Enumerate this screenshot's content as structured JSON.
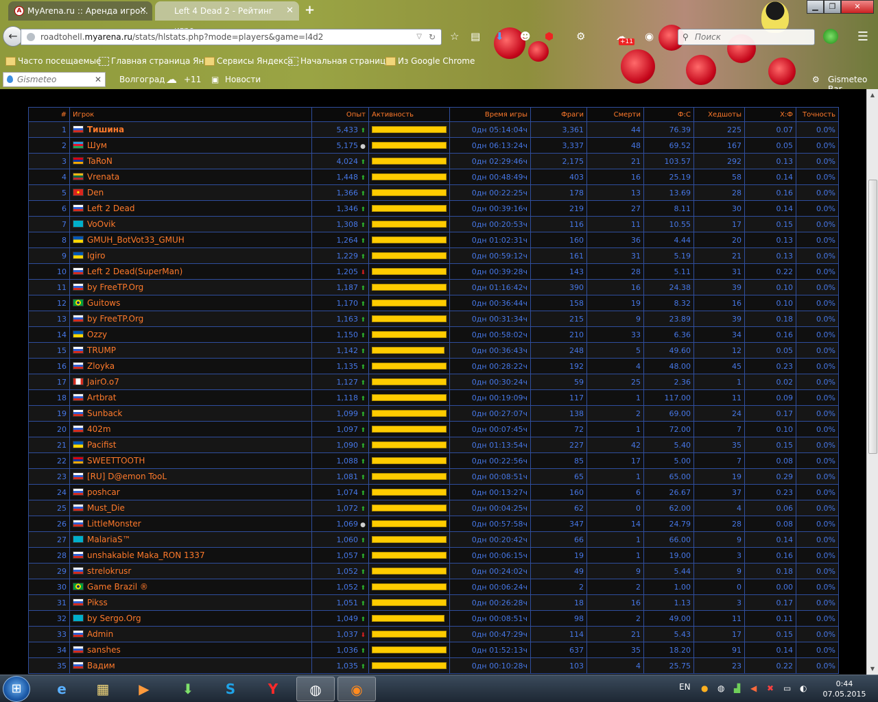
{
  "browser": {
    "tabs": [
      {
        "title": "MyArena.ru :: Аренда игро...",
        "active": false
      },
      {
        "title": "Left 4 Dead 2 - Рейтинг игро...",
        "active": true
      }
    ],
    "url_path_pre": "roadtohell.",
    "url_host": "myarena.ru",
    "url_path_post": "/stats/hlstats.php?mode=players&game=l4d2",
    "search_placeholder": "Поиск",
    "bookmarks": [
      "Часто посещаемые",
      "Главная страница Ян...",
      "Сервисы Яндекса",
      "Начальная страница",
      "Из Google Chrome"
    ],
    "gismeteo": {
      "search_placeholder": "Gismeteo",
      "city": "Волгоград",
      "temp": "+11",
      "news": "Новости",
      "bar_label": "Gismeteo Bar"
    },
    "badge": "+11"
  },
  "table": {
    "headers": [
      "#",
      "Игрок",
      "Опыт",
      "Активность",
      "Время игры",
      "Фраги",
      "Смерти",
      "Ф:С",
      "Хедшоты",
      "Х:Ф",
      "Точность"
    ],
    "rows": [
      {
        "rank": "1",
        "flag": "ru",
        "name": "Тишина",
        "bold": true,
        "exp": "5,433",
        "trend": "up",
        "activity": 1.0,
        "time": "0дн 05:14:04ч",
        "kills": "3,361",
        "deaths": "44",
        "kd": "76.39",
        "hs": "225",
        "hk": "0.07",
        "acc": "0.0%"
      },
      {
        "rank": "2",
        "flag": "az",
        "name": "Шум",
        "exp": "5,175",
        "trend": "same",
        "activity": 1.0,
        "time": "0дн 06:13:24ч",
        "kills": "3,337",
        "deaths": "48",
        "kd": "69.52",
        "hs": "167",
        "hk": "0.05",
        "acc": "0.0%"
      },
      {
        "rank": "3",
        "flag": "am",
        "name": "TaRoN",
        "exp": "4,024",
        "trend": "up",
        "activity": 1.0,
        "time": "0дн 02:29:46ч",
        "kills": "2,175",
        "deaths": "21",
        "kd": "103.57",
        "hs": "292",
        "hk": "0.13",
        "acc": "0.0%"
      },
      {
        "rank": "4",
        "flag": "lt",
        "name": "Vrenata",
        "exp": "1,448",
        "trend": "up",
        "activity": 1.0,
        "time": "0дн 00:48:49ч",
        "kills": "403",
        "deaths": "16",
        "kd": "25.19",
        "hs": "58",
        "hk": "0.14",
        "acc": "0.0%"
      },
      {
        "rank": "5",
        "flag": "vn",
        "name": "Den",
        "exp": "1,366",
        "trend": "up",
        "activity": 1.0,
        "time": "0дн 00:22:25ч",
        "kills": "178",
        "deaths": "13",
        "kd": "13.69",
        "hs": "28",
        "hk": "0.16",
        "acc": "0.0%"
      },
      {
        "rank": "6",
        "flag": "ru",
        "name": "Left 2 Dead",
        "exp": "1,346",
        "trend": "up",
        "activity": 1.0,
        "time": "0дн 00:39:16ч",
        "kills": "219",
        "deaths": "27",
        "kd": "8.11",
        "hs": "30",
        "hk": "0.14",
        "acc": "0.0%"
      },
      {
        "rank": "7",
        "flag": "kz",
        "name": "VoOvik",
        "exp": "1,308",
        "trend": "up",
        "activity": 1.0,
        "time": "0дн 00:20:53ч",
        "kills": "116",
        "deaths": "11",
        "kd": "10.55",
        "hs": "17",
        "hk": "0.15",
        "acc": "0.0%"
      },
      {
        "rank": "8",
        "flag": "ua",
        "name": "GMUH_BotVot33_GMUH",
        "exp": "1,264",
        "trend": "up",
        "activity": 1.0,
        "time": "0дн 01:02:31ч",
        "kills": "160",
        "deaths": "36",
        "kd": "4.44",
        "hs": "20",
        "hk": "0.13",
        "acc": "0.0%"
      },
      {
        "rank": "9",
        "flag": "ua",
        "name": "Igiro",
        "exp": "1,229",
        "trend": "up",
        "activity": 1.0,
        "time": "0дн 00:59:12ч",
        "kills": "161",
        "deaths": "31",
        "kd": "5.19",
        "hs": "21",
        "hk": "0.13",
        "acc": "0.0%"
      },
      {
        "rank": "10",
        "flag": "ru",
        "name": "Left 2 Dead(SuperMan)",
        "exp": "1,205",
        "trend": "down",
        "activity": 1.0,
        "time": "0дн 00:39:28ч",
        "kills": "143",
        "deaths": "28",
        "kd": "5.11",
        "hs": "31",
        "hk": "0.22",
        "acc": "0.0%"
      },
      {
        "rank": "11",
        "flag": "ru",
        "name": "by FreeTP.Org",
        "exp": "1,187",
        "trend": "up",
        "activity": 1.0,
        "time": "0дн 01:16:42ч",
        "kills": "390",
        "deaths": "16",
        "kd": "24.38",
        "hs": "39",
        "hk": "0.10",
        "acc": "0.0%"
      },
      {
        "rank": "12",
        "flag": "br",
        "name": "Guitows",
        "exp": "1,170",
        "trend": "up",
        "activity": 1.0,
        "time": "0дн 00:36:44ч",
        "kills": "158",
        "deaths": "19",
        "kd": "8.32",
        "hs": "16",
        "hk": "0.10",
        "acc": "0.0%"
      },
      {
        "rank": "13",
        "flag": "ru",
        "name": "by FreeTP.Org",
        "exp": "1,163",
        "trend": "up",
        "activity": 1.0,
        "time": "0дн 00:31:34ч",
        "kills": "215",
        "deaths": "9",
        "kd": "23.89",
        "hs": "39",
        "hk": "0.18",
        "acc": "0.0%"
      },
      {
        "rank": "14",
        "flag": "ua",
        "name": "Ozzy",
        "exp": "1,150",
        "trend": "up",
        "activity": 1.0,
        "time": "0дн 00:58:02ч",
        "kills": "210",
        "deaths": "33",
        "kd": "6.36",
        "hs": "34",
        "hk": "0.16",
        "acc": "0.0%"
      },
      {
        "rank": "15",
        "flag": "ru",
        "name": "TRUMP",
        "exp": "1,142",
        "trend": "up",
        "activity": 0.97,
        "time": "0дн 00:36:43ч",
        "kills": "248",
        "deaths": "5",
        "kd": "49.60",
        "hs": "12",
        "hk": "0.05",
        "acc": "0.0%"
      },
      {
        "rank": "16",
        "flag": "ru",
        "name": "Zloyka",
        "exp": "1,135",
        "trend": "up",
        "activity": 1.0,
        "time": "0дн 00:28:22ч",
        "kills": "192",
        "deaths": "4",
        "kd": "48.00",
        "hs": "45",
        "hk": "0.23",
        "acc": "0.0%"
      },
      {
        "rank": "17",
        "flag": "ca",
        "name": "JairO.o7",
        "exp": "1,127",
        "trend": "up",
        "activity": 1.0,
        "time": "0дн 00:30:24ч",
        "kills": "59",
        "deaths": "25",
        "kd": "2.36",
        "hs": "1",
        "hk": "0.02",
        "acc": "0.0%"
      },
      {
        "rank": "18",
        "flag": "ru",
        "name": "Artbrat",
        "exp": "1,118",
        "trend": "up",
        "activity": 1.0,
        "time": "0дн 00:19:09ч",
        "kills": "117",
        "deaths": "1",
        "kd": "117.00",
        "hs": "11",
        "hk": "0.09",
        "acc": "0.0%"
      },
      {
        "rank": "19",
        "flag": "ru",
        "name": "Sunback",
        "exp": "1,099",
        "trend": "up",
        "activity": 1.0,
        "time": "0дн 00:27:07ч",
        "kills": "138",
        "deaths": "2",
        "kd": "69.00",
        "hs": "24",
        "hk": "0.17",
        "acc": "0.0%"
      },
      {
        "rank": "20",
        "flag": "ru",
        "name": "402m",
        "exp": "1,097",
        "trend": "up",
        "activity": 1.0,
        "time": "0дн 00:07:45ч",
        "kills": "72",
        "deaths": "1",
        "kd": "72.00",
        "hs": "7",
        "hk": "0.10",
        "acc": "0.0%"
      },
      {
        "rank": "21",
        "flag": "ua",
        "name": "Pacifist",
        "exp": "1,090",
        "trend": "up",
        "activity": 1.0,
        "time": "0дн 01:13:54ч",
        "kills": "227",
        "deaths": "42",
        "kd": "5.40",
        "hs": "35",
        "hk": "0.15",
        "acc": "0.0%"
      },
      {
        "rank": "22",
        "flag": "am",
        "name": "SWEETTOOTH",
        "exp": "1,088",
        "trend": "up",
        "activity": 1.0,
        "time": "0дн 00:22:56ч",
        "kills": "85",
        "deaths": "17",
        "kd": "5.00",
        "hs": "7",
        "hk": "0.08",
        "acc": "0.0%"
      },
      {
        "rank": "23",
        "flag": "ru",
        "name": "[RU] D@emon TooL",
        "exp": "1,081",
        "trend": "up",
        "activity": 1.0,
        "time": "0дн 00:08:51ч",
        "kills": "65",
        "deaths": "1",
        "kd": "65.00",
        "hs": "19",
        "hk": "0.29",
        "acc": "0.0%"
      },
      {
        "rank": "24",
        "flag": "ru",
        "name": "poshcar",
        "exp": "1,074",
        "trend": "up",
        "activity": 1.0,
        "time": "0дн 00:13:27ч",
        "kills": "160",
        "deaths": "6",
        "kd": "26.67",
        "hs": "37",
        "hk": "0.23",
        "acc": "0.0%"
      },
      {
        "rank": "25",
        "flag": "ru",
        "name": "Must_Die",
        "exp": "1,072",
        "trend": "up",
        "activity": 1.0,
        "time": "0дн 00:04:25ч",
        "kills": "62",
        "deaths": "0",
        "kd": "62.00",
        "hs": "4",
        "hk": "0.06",
        "acc": "0.0%"
      },
      {
        "rank": "26",
        "flag": "ru",
        "name": "LittleMonster",
        "exp": "1,069",
        "trend": "same",
        "activity": 1.0,
        "time": "0дн 00:57:58ч",
        "kills": "347",
        "deaths": "14",
        "kd": "24.79",
        "hs": "28",
        "hk": "0.08",
        "acc": "0.0%"
      },
      {
        "rank": "27",
        "flag": "kz",
        "name": "MalariaS™",
        "exp": "1,060",
        "trend": "up",
        "activity": 1.0,
        "time": "0дн 00:20:42ч",
        "kills": "66",
        "deaths": "1",
        "kd": "66.00",
        "hs": "9",
        "hk": "0.14",
        "acc": "0.0%"
      },
      {
        "rank": "28",
        "flag": "ru",
        "name": "unshakable Maka_RON 1337",
        "exp": "1,057",
        "trend": "up",
        "activity": 1.0,
        "time": "0дн 00:06:15ч",
        "kills": "19",
        "deaths": "1",
        "kd": "19.00",
        "hs": "3",
        "hk": "0.16",
        "acc": "0.0%"
      },
      {
        "rank": "29",
        "flag": "ru",
        "name": "strelokrusr",
        "exp": "1,052",
        "trend": "up",
        "activity": 1.0,
        "time": "0дн 00:24:02ч",
        "kills": "49",
        "deaths": "9",
        "kd": "5.44",
        "hs": "9",
        "hk": "0.18",
        "acc": "0.0%"
      },
      {
        "rank": "30",
        "flag": "br",
        "name": "Game Brazil ®",
        "exp": "1,052",
        "trend": "up",
        "activity": 1.0,
        "time": "0дн 00:06:24ч",
        "kills": "2",
        "deaths": "2",
        "kd": "1.00",
        "hs": "0",
        "hk": "0.00",
        "acc": "0.0%"
      },
      {
        "rank": "31",
        "flag": "ru",
        "name": "Pikss",
        "exp": "1,051",
        "trend": "up",
        "activity": 1.0,
        "time": "0дн 00:26:28ч",
        "kills": "18",
        "deaths": "16",
        "kd": "1.13",
        "hs": "3",
        "hk": "0.17",
        "acc": "0.0%"
      },
      {
        "rank": "32",
        "flag": "kz",
        "name": "by Sergo.Org",
        "exp": "1,049",
        "trend": "up",
        "activity": 0.97,
        "time": "0дн 00:08:51ч",
        "kills": "98",
        "deaths": "2",
        "kd": "49.00",
        "hs": "11",
        "hk": "0.11",
        "acc": "0.0%"
      },
      {
        "rank": "33",
        "flag": "ru",
        "name": "Admin",
        "exp": "1,037",
        "trend": "down",
        "activity": 1.0,
        "time": "0дн 00:47:29ч",
        "kills": "114",
        "deaths": "21",
        "kd": "5.43",
        "hs": "17",
        "hk": "0.15",
        "acc": "0.0%"
      },
      {
        "rank": "34",
        "flag": "ru",
        "name": "sanshes",
        "exp": "1,036",
        "trend": "up",
        "activity": 1.0,
        "time": "0дн 01:52:13ч",
        "kills": "637",
        "deaths": "35",
        "kd": "18.20",
        "hs": "91",
        "hk": "0.14",
        "acc": "0.0%"
      },
      {
        "rank": "35",
        "flag": "ru",
        "name": "Вадим",
        "exp": "1,035",
        "trend": "up",
        "activity": 1.0,
        "time": "0дн 00:10:28ч",
        "kills": "103",
        "deaths": "4",
        "kd": "25.75",
        "hs": "23",
        "hk": "0.22",
        "acc": "0.0%"
      }
    ]
  },
  "taskbar": {
    "lang": "EN",
    "time": "0:44",
    "date": "07.05.2015",
    "apps": [
      "ie-icon",
      "explorer-icon",
      "media-player-icon",
      "download-icon",
      "skype-icon",
      "yandex-icon",
      "steam-icon",
      "firefox-icon"
    ]
  },
  "colors": {
    "accent_orange": "#ff7a2b",
    "number_blue": "#4677e6",
    "bar_yellow": "#ffcc00",
    "grid_blue": "#2f4e9e"
  }
}
